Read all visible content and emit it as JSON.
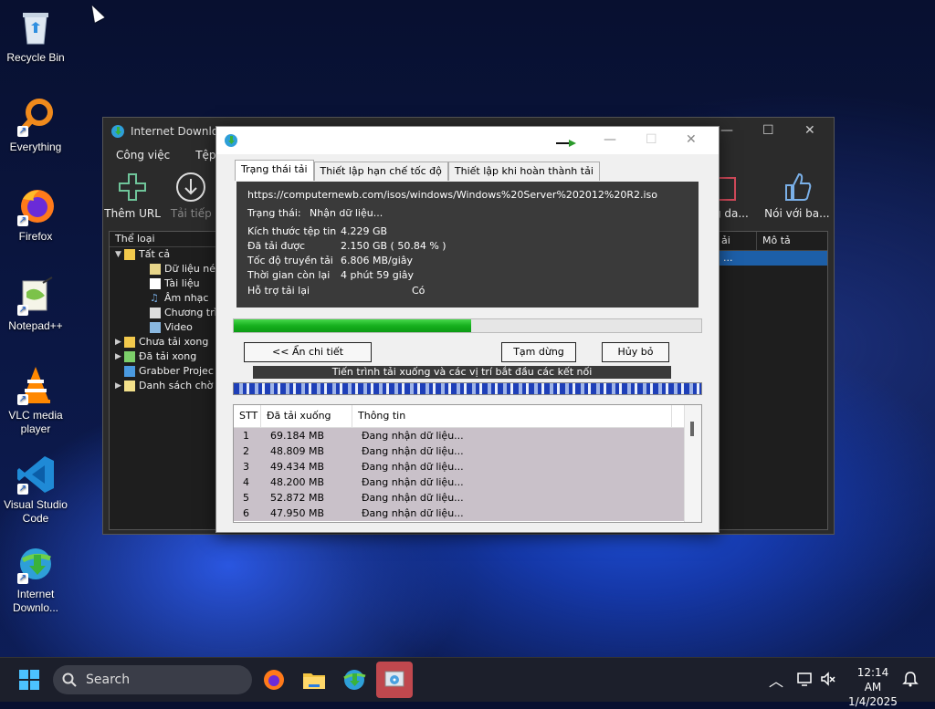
{
  "desktop": {
    "icons": [
      {
        "label": "Recycle Bin"
      },
      {
        "label": "Everything"
      },
      {
        "label": "Firefox"
      },
      {
        "label": "Notepad++"
      },
      {
        "label": "VLC media player"
      },
      {
        "label": "Visual Studio Code"
      },
      {
        "label": "Internet Downlo..."
      }
    ]
  },
  "idm_main": {
    "title": "Internet Downloa",
    "menu": [
      "Công việc",
      "Tệp tin"
    ],
    "toolbar": [
      "Thêm URL",
      "Tải tiếp",
      "ng da...",
      "Nói với ba..."
    ],
    "category_header": "Thể loại",
    "tree": [
      {
        "label": "Tất cả"
      },
      {
        "label": "Dữ liệu nén"
      },
      {
        "label": "Tài liệu"
      },
      {
        "label": "Âm nhạc"
      },
      {
        "label": "Chương trì"
      },
      {
        "label": "Video"
      },
      {
        "label": "Chưa tải xong"
      },
      {
        "label": "Đã tải xong"
      },
      {
        "label": "Grabber Projec"
      },
      {
        "label": "Danh sách chờ"
      }
    ],
    "list_cols": [
      "ải",
      "Mô tả"
    ],
    "list_selected": "..."
  },
  "dialog": {
    "tabs": [
      "Trạng thái tải",
      "Thiết lập hạn chế tốc độ",
      "Thiết lập khi hoàn thành tải"
    ],
    "url": "https://computernewb.com/isos/windows/Windows%20Server%202012%20R2.iso",
    "status_label": "Trạng thái:",
    "status_value": "Nhận dữ liệu...",
    "rows": [
      {
        "label": "Kích thước tệp tin",
        "value": "4.229  GB"
      },
      {
        "label": "Đã tải được",
        "value": "2.150  GB  ( 50.84 % )"
      },
      {
        "label": "Tốc độ truyền tải",
        "value": "6.806  MB/giây"
      },
      {
        "label": "Thời gian còn lại",
        "value": "4 phút 59 giây"
      },
      {
        "label": "Hỗ trợ tải lại",
        "value": "Có"
      }
    ],
    "progress_percent": 50.84,
    "buttons": {
      "hide": "<< Ẩn chi tiết",
      "pause": "Tạm dừng",
      "cancel": "Hủy bỏ"
    },
    "connections_label": "Tiến trình tải xuống và các vị trí bắt đầu các kết nối",
    "table_headers": [
      "STT",
      "Đã tải xuống",
      "Thông tin"
    ],
    "threads": [
      {
        "n": "1",
        "size": "69.184  MB",
        "info": "Đang nhận dữ liệu..."
      },
      {
        "n": "2",
        "size": "48.809  MB",
        "info": "Đang nhận dữ liệu..."
      },
      {
        "n": "3",
        "size": "49.434  MB",
        "info": "Đang nhận dữ liệu..."
      },
      {
        "n": "4",
        "size": "48.200  MB",
        "info": "Đang nhận dữ liệu..."
      },
      {
        "n": "5",
        "size": "52.872  MB",
        "info": "Đang nhận dữ liệu..."
      },
      {
        "n": "6",
        "size": "47.950  MB",
        "info": "Đang nhận dữ liệu..."
      }
    ]
  },
  "taskbar": {
    "search_placeholder": "Search",
    "time": "12:14 AM",
    "date": "1/4/2025"
  }
}
